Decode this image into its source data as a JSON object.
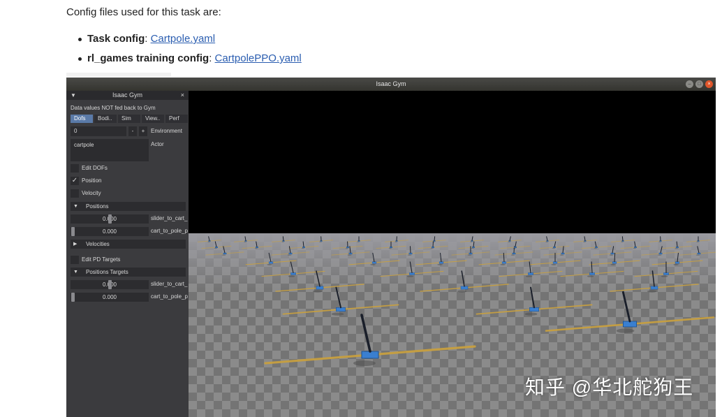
{
  "doc": {
    "intro": "Config files used for this task are:",
    "items": [
      {
        "label": "Task config",
        "sep": ": ",
        "link": "Cartpole.yaml"
      },
      {
        "label": "rl_games training config",
        "sep": ": ",
        "link": "CartpolePPO.yaml"
      }
    ]
  },
  "window": {
    "title": "Isaac Gym",
    "controls": [
      "–",
      "□",
      "×"
    ]
  },
  "gui": {
    "title": "Isaac Gym",
    "collapse_glyph": "▼",
    "close_glyph": "×",
    "note": "Data values NOT fed back to Gym",
    "tabs": [
      "Dofs",
      "Bodi..",
      "Sim",
      "View..",
      "Perf"
    ],
    "active_tab": "Dofs",
    "env_value": "0",
    "minus": "-",
    "plus": "+",
    "env_label": "Environment",
    "actor_value": "cartpole",
    "actor_label": "Actor",
    "edit_dofs": "Edit DOFs",
    "position": "Position",
    "velocity": "Velocity",
    "check_glyph": "✓",
    "positions_section": "Positions",
    "positions": [
      {
        "value": "0.000",
        "label": "slider_to_cart_",
        "knob": 0.5
      },
      {
        "value": "0.000",
        "label": "cart_to_pole_p",
        "knob": 0.0
      }
    ],
    "velocities_section": "Velocities",
    "edit_pd": "Edit PD Targets",
    "targets_section": "Positions Targets",
    "targets": [
      {
        "value": "0.000",
        "label": "slider_to_cart_",
        "knob": 0.5
      },
      {
        "value": "0.000",
        "label": "cart_to_pole_p",
        "knob": 0.0
      }
    ],
    "collapsed_glyph": "▶",
    "expanded_glyph": "▼"
  },
  "colors": {
    "link": "#2a5db0",
    "panel": "#3b3b3e",
    "active_tab": "#5a7aa8",
    "cart": "#3a7fd0",
    "rail": "#c8a040"
  },
  "watermark": "知乎 @华北舵狗王"
}
